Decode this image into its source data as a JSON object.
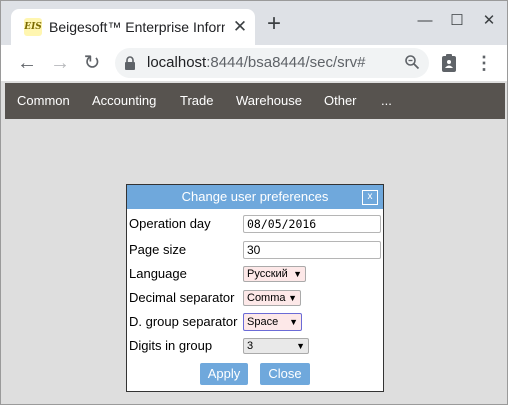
{
  "browser": {
    "tab_title": "Beigesoft™ Enterprise Information System",
    "favicon_text": "EIS",
    "new_tab_glyph": "+",
    "url_host": "localhost",
    "url_path": ":8444/bsa8444/sec/srv#"
  },
  "menubar": {
    "items": [
      "Common",
      "Accounting",
      "Trade",
      "Warehouse",
      "Other",
      "..."
    ]
  },
  "dialog": {
    "title": "Change user preferences",
    "close_label": "x",
    "fields": {
      "operation_day": {
        "label": "Operation day",
        "value": "08/05/2016"
      },
      "page_size": {
        "label": "Page size",
        "value": "30"
      },
      "language": {
        "label": "Language",
        "value": "Русский"
      },
      "decimal_separator": {
        "label": "Decimal separator",
        "value": "Comma"
      },
      "group_separator": {
        "label": "D. group separator",
        "value": "Space"
      },
      "digits_in_group": {
        "label": "Digits in group",
        "value": "3"
      }
    },
    "apply_label": "Apply",
    "close_button_label": "Close"
  },
  "colors": {
    "menubar_bg": "#57534f",
    "dialog_header_bg": "#6fa8dc",
    "page_bg": "#dedede",
    "select_highlight_bg": "#fde8e8"
  }
}
